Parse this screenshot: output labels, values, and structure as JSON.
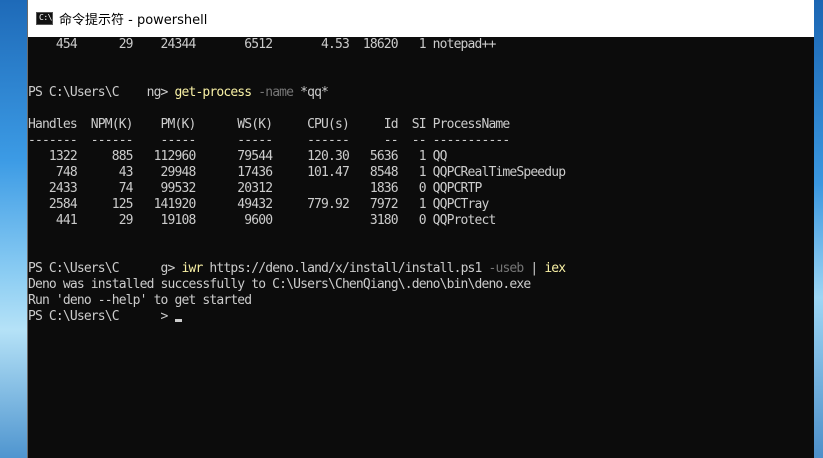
{
  "window": {
    "title": "命令提示符 - powershell",
    "icon": "console-icon",
    "icon_glyph": "C:\\"
  },
  "console": {
    "lines": [
      {
        "text": "    454      29    24344       6512       4.53  18620   1 notepad++"
      },
      {
        "text": ""
      },
      {
        "text": ""
      },
      {
        "prompt": "PS C:\\Users\\C    ng> ",
        "cmd": "get-process",
        "param": " -name",
        "rest": " *qq*"
      },
      {
        "text": ""
      },
      {
        "text": "Handles  NPM(K)    PM(K)      WS(K)     CPU(s)     Id  SI ProcessName"
      },
      {
        "text": "-------  ------    -----      -----     ------     --  -- -----------"
      },
      {
        "text": "   1322     885   112960      79544     120.30   5636   1 QQ"
      },
      {
        "text": "    748      43    29948      17436     101.47   8548   1 QQPCRealTimeSpeedup"
      },
      {
        "text": "   2433      74    99532      20312              1836   0 QQPCRTP"
      },
      {
        "text": "   2584     125   141920      49432     779.92   7972   1 QQPCTray"
      },
      {
        "text": "    441      29    19108       9600              3180   0 QQProtect"
      },
      {
        "text": ""
      },
      {
        "text": ""
      },
      {
        "prompt": "PS C:\\Users\\C      g> ",
        "cmd": "iwr",
        "rest": " https://deno.land/x/install/install.ps1",
        "param": " -useb",
        "rest2": " | ",
        "cmd2": "iex"
      },
      {
        "text": "Deno was installed successfully to C:\\Users\\ChenQiang\\.deno\\bin\\deno.exe"
      },
      {
        "text": "Run 'deno --help' to get started"
      },
      {
        "prompt": "PS C:\\Users\\C      > ",
        "cursor": true
      }
    ]
  },
  "colors": {
    "console_bg": "#0c0c0c",
    "console_fg": "#cccccc",
    "command": "#f9f1a5",
    "parameter": "#767676"
  }
}
